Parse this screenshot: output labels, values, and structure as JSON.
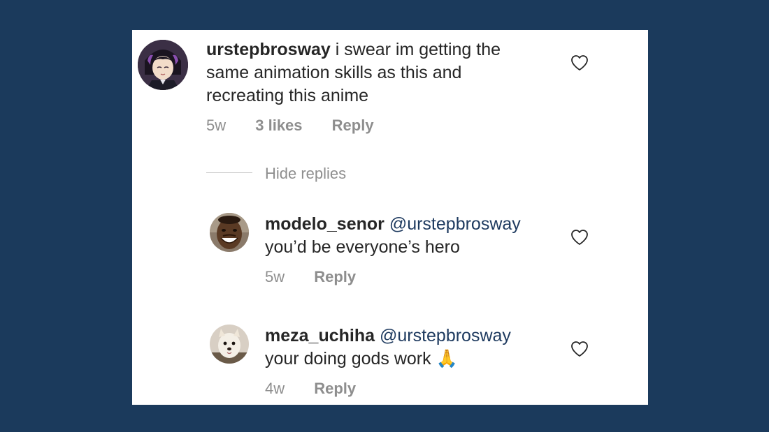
{
  "comments": [
    {
      "username": "urstepbrosway",
      "mention": "",
      "text": " i swear im getting the same animation skills as this and recreating this anime",
      "age": "5w",
      "likes": "3 likes",
      "reply_label": "Reply",
      "icons": {
        "avatar": "anime-avatar",
        "like": "heart-icon"
      }
    },
    {
      "username": "modelo_senor",
      "mention": "@urstepbrosway",
      "text": "you’d be everyone’s hero",
      "age": "5w",
      "reply_label": "Reply",
      "icons": {
        "avatar": "smiling-man-avatar",
        "like": "heart-icon"
      }
    },
    {
      "username": "meza_uchiha",
      "mention": "@urstepbrosway",
      "text": "your doing gods work",
      "emoji": "🙏",
      "age": "4w",
      "reply_label": "Reply",
      "icons": {
        "avatar": "dog-avatar",
        "like": "heart-icon"
      }
    }
  ],
  "hide_replies_label": "Hide replies",
  "colors": {
    "background": "#1b3a5c",
    "card": "#ffffff",
    "text": "#262626",
    "muted": "#8e8e8e",
    "mention": "#1e3a5f"
  }
}
